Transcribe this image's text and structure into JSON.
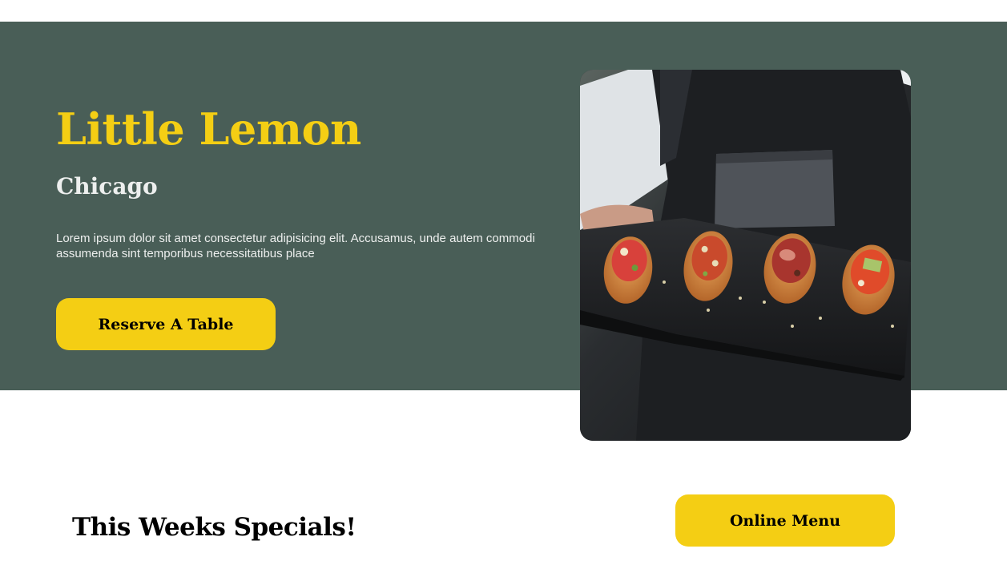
{
  "hero": {
    "title": "Little Lemon",
    "subtitle": "Chicago",
    "description": "Lorem ipsum dolor sit amet consectetur adipisicing elit. Accusamus, unde autem commodi assumenda sint temporibus necessitatibus place",
    "reserve_button_label": "Reserve A Table",
    "image_alt": "chef-holding-bruschetta-platter-photo"
  },
  "specials": {
    "title": "This Weeks Specials!",
    "online_menu_button_label": "Online Menu"
  },
  "colors": {
    "primary_green": "#495e57",
    "primary_yellow": "#f4ce14",
    "light_text": "#edefee",
    "background": "#ffffff"
  }
}
